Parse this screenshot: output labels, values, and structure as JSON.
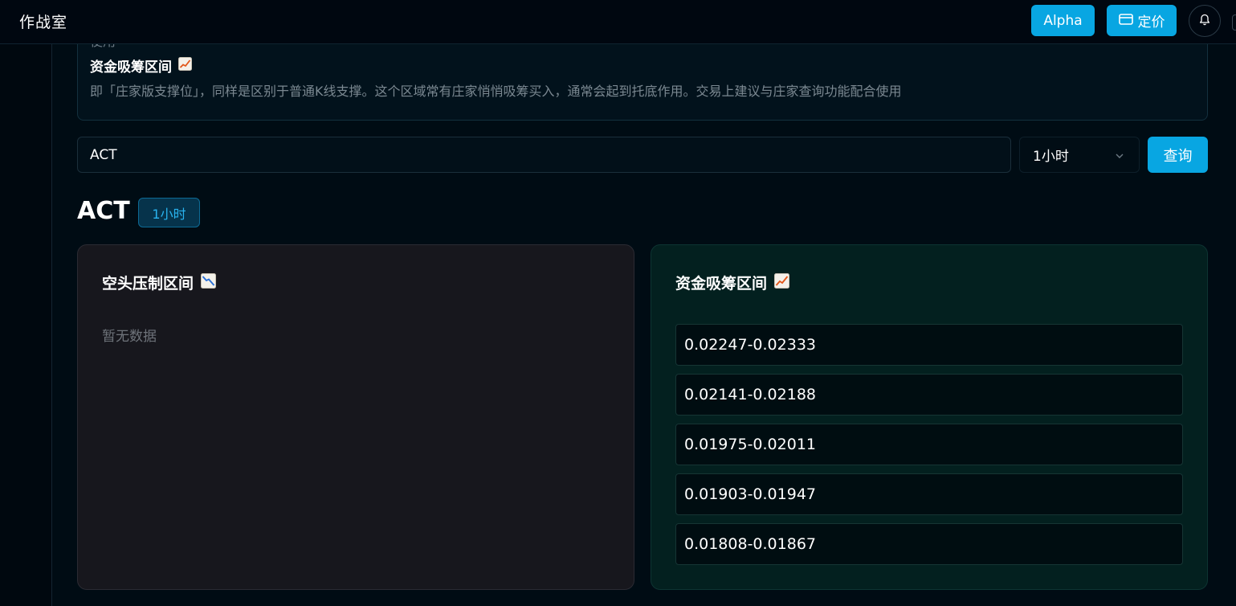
{
  "header": {
    "title": "作战室",
    "alpha_label": "Alpha",
    "pricing_label": "定价",
    "icons": [
      "card-icon",
      "bell-icon"
    ]
  },
  "info": {
    "prev_text": "使用",
    "heading": "资金吸筹区间",
    "description": "即「庄家版支撑位」，同样是区别于普通K线支撑。这个区域常有庄家悄悄吸筹买入，通常会起到托底作用。交易上建议与庄家查询功能配合使用"
  },
  "search": {
    "value": "ACT",
    "interval": "1小时",
    "query_label": "查询"
  },
  "result": {
    "symbol": "ACT",
    "interval_badge": "1小时"
  },
  "short_panel": {
    "title": "空头压制区间",
    "empty_text": "暂无数据"
  },
  "accum_panel": {
    "title": "资金吸筹区间",
    "ranges": [
      "0.02247-0.02333",
      "0.02141-0.02188",
      "0.01975-0.02011",
      "0.01903-0.01947",
      "0.01808-0.01867"
    ]
  },
  "colors": {
    "accent": "#08a6e2",
    "background": "#000c14",
    "short_panel_bg": "#17171d",
    "accum_panel_bg": "#03201f"
  }
}
